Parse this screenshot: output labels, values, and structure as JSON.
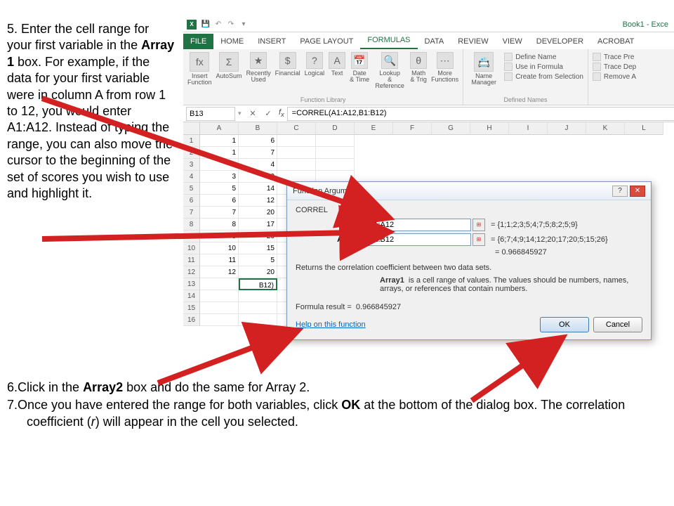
{
  "instructions": {
    "step5": "Enter the cell range for your first variable in the <b>Array 1</b> box. For example, if the data for your first variable were in column A from row 1 to 12, you would enter A1:A12. Instead of typing the range, you can also move the cursor to the beginning of the set of scores you wish to use and highlight it.",
    "step6": "Click in the <b>Array2</b> box and do the same for Array 2.",
    "step7": "Once you have entered the range for both variables, click <b>OK</b> at the bottom of the dialog box. The correlation coefficient (<i>r</i>) will appear in the cell you selected."
  },
  "excel": {
    "title": "Book1 - Exce",
    "tabs": [
      "FILE",
      "HOME",
      "INSERT",
      "PAGE LAYOUT",
      "FORMULAS",
      "DATA",
      "REVIEW",
      "VIEW",
      "DEVELOPER",
      "Acrobat"
    ],
    "activeTab": "FORMULAS",
    "ribbon": {
      "buttons": [
        "Insert Function",
        "AutoSum",
        "Recently Used",
        "Financial",
        "Logical",
        "Text",
        "Date & Time",
        "Lookup & Reference",
        "Math & Trig",
        "More Functions"
      ],
      "group1Label": "Function Library",
      "nameManager": "Name Manager",
      "defined": [
        "Define Name",
        "Use in Formula",
        "Create from Selection"
      ],
      "group2Label": "Defined Names",
      "trace": [
        "Trace Pre",
        "Trace Dep",
        "Remove A"
      ]
    },
    "namebox": "B13",
    "formula": "=CORREL(A1:A12,B1:B12)",
    "columns": [
      "A",
      "B",
      "C",
      "D",
      "E",
      "F",
      "G",
      "H",
      "I",
      "J",
      "K",
      "L"
    ],
    "rows": 16,
    "colA": [
      "1",
      "1",
      "2",
      "3",
      "5",
      "6",
      "7",
      "8",
      "9",
      "10",
      "11",
      "12"
    ],
    "colB": [
      "6",
      "7",
      "4",
      "9",
      "14",
      "12",
      "20",
      "17",
      "20",
      "15",
      "5",
      "20"
    ],
    "b13": "B12)",
    "selRow": 13,
    "selCol": "B"
  },
  "dialog": {
    "title": "Function Arguments",
    "funcName": "CORREL",
    "array1Label": "Array1",
    "array1": "A1:A12",
    "array1Prev": "= {1;1;2;3;5;4;7;5;8;2;5;9}",
    "array2Label": "Array2",
    "array2": "B1:B12",
    "array2Prev": "= {6;7;4;9;14;12;20;17;20;5;15;26}",
    "resultPrev": "= 0.966845927",
    "description": "Returns the correlation coefficient between two data sets.",
    "argDesc": "is a cell range of values. The values should be numbers, names, arrays, or references that contain numbers.",
    "argDescLabel": "Array1",
    "formulaResultLabel": "Formula result =",
    "formulaResult": "0.966845927",
    "helpLink": "Help on this function",
    "ok": "OK",
    "cancel": "Cancel"
  }
}
